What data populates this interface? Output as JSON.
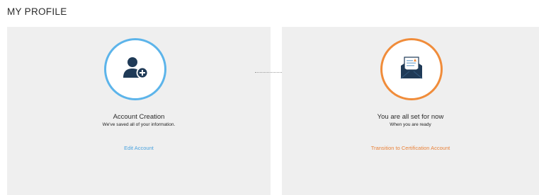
{
  "header": {
    "title": "MY PROFILE"
  },
  "steps": [
    {
      "title": "Account Creation",
      "subtitle": "We've saved all of your information.",
      "link": "Edit Account",
      "icon": "user-add-icon",
      "accent": "#5cb4ea"
    },
    {
      "title": "You are all set for now",
      "subtitle": "When you are ready",
      "link": "Transition to Certification Account",
      "icon": "envelope-letter-icon",
      "accent": "#f08c3a"
    }
  ],
  "colors": {
    "card_bg": "#efefef",
    "icon_dark": "#1f3a57",
    "blue_link": "#4aa3df",
    "orange_link": "#e9823a"
  }
}
